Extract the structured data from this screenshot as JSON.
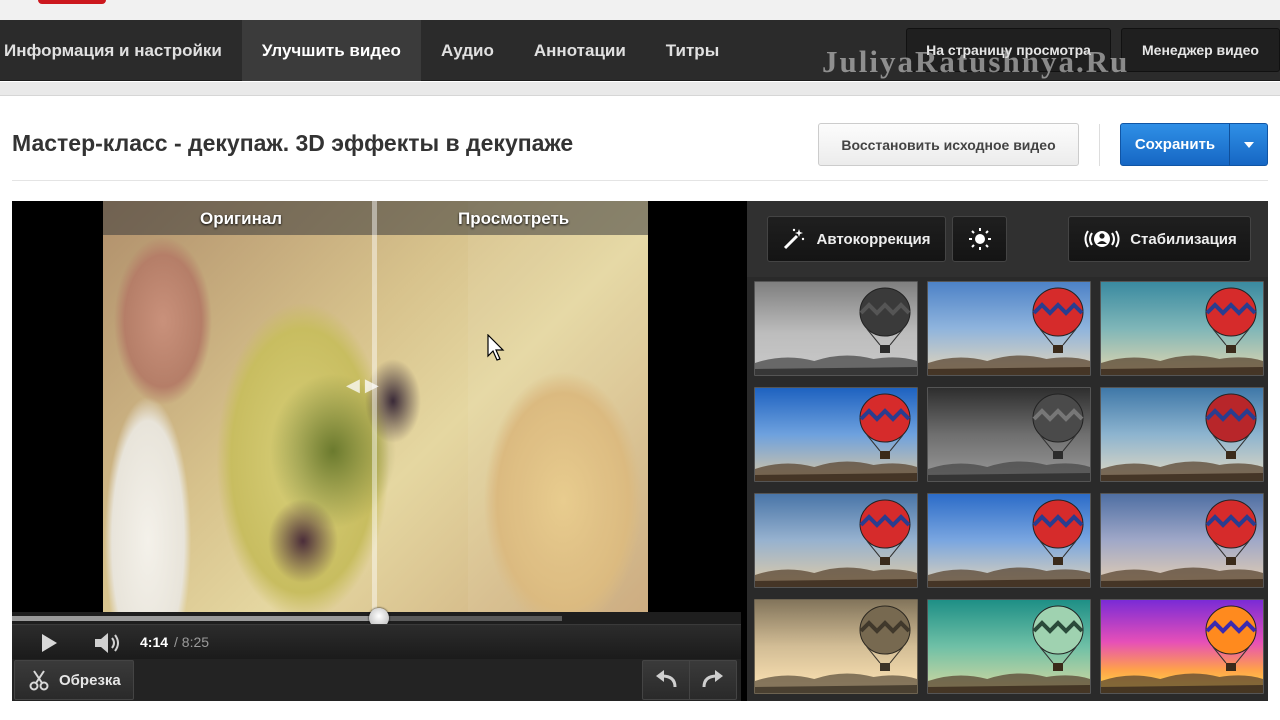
{
  "nav": {
    "tabs": [
      {
        "label": "Информация и настройки",
        "active": false
      },
      {
        "label": "Улучшить видео",
        "active": true
      },
      {
        "label": "Аудио",
        "active": false
      },
      {
        "label": "Аннотации",
        "active": false
      },
      {
        "label": "Титры",
        "active": false
      }
    ],
    "watch_page_label": "На страницу просмотра",
    "video_manager_label": "Менеджер видео",
    "watermark": "JuliyaRatushnya.Ru"
  },
  "header": {
    "title": "Мастер-класс - декупаж. 3D эффекты в декупаже",
    "restore_label": "Восстановить исходное видео",
    "save_label": "Сохранить"
  },
  "player": {
    "original_label": "Оригинал",
    "preview_label": "Просмотреть",
    "time_current": "4:14",
    "time_total": "/ 8:25",
    "progress_fraction": 0.503,
    "trim_label": "Обрезка"
  },
  "panel": {
    "autocorrect_label": "Автокоррекция",
    "stabilize_label": "Стабилизация",
    "filter_count": 12
  },
  "colors": {
    "nav_bg": "#2b2b2b",
    "accent_blue": "#1f7ad8",
    "panel_bg": "#2a2a2a"
  }
}
